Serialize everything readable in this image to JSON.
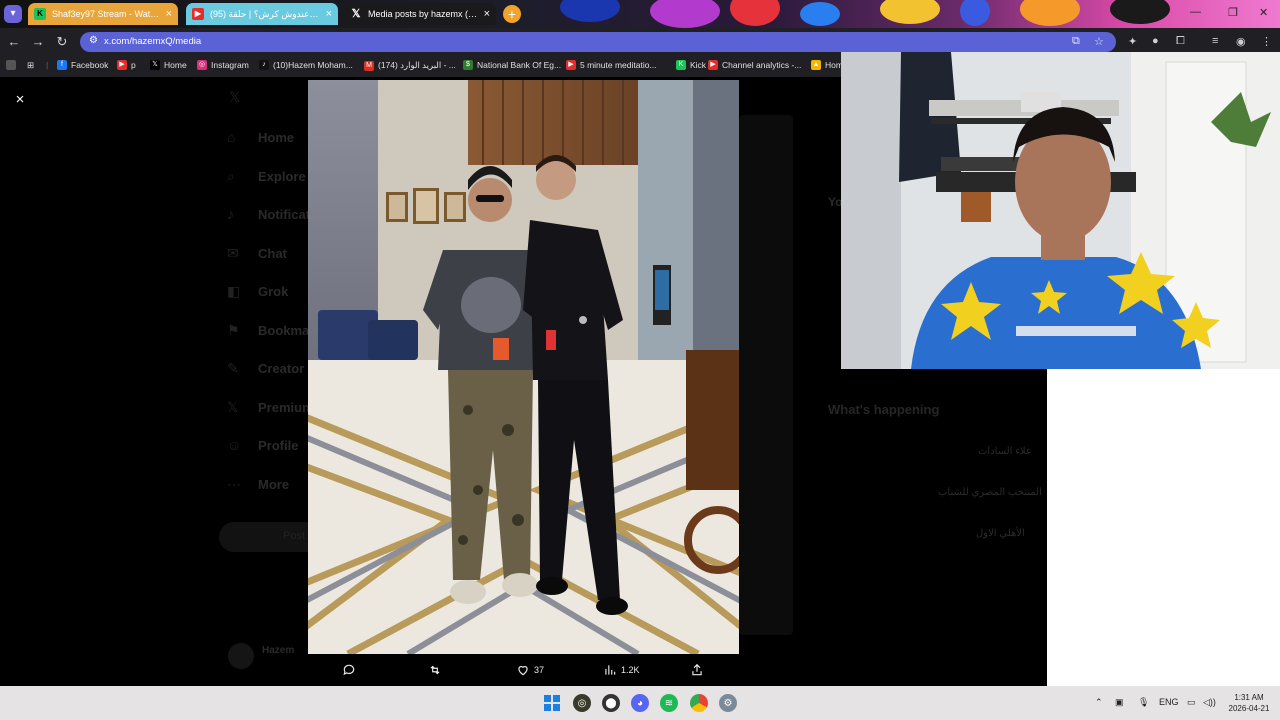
{
  "browser": {
    "tabs": [
      {
        "label": "Shaf3ey97 Stream - Watch Live",
        "favicon": "kick-icon",
        "close": "×"
      },
      {
        "label": "(95) مين ماعندوش كرش؟ | حلقة",
        "favicon": "youtube-icon",
        "close": "×"
      },
      {
        "label": "Media posts by hazemx (@hazemxQ)",
        "favicon": "x-icon",
        "close": "×"
      }
    ],
    "new_tab": "+",
    "url": "x.com/hazemxQ/media",
    "bookmarks": [
      {
        "label": "Facebook",
        "icon": "facebook-icon",
        "color": "#1877f2"
      },
      {
        "label": "p",
        "icon": "youtube-icon",
        "color": "#e62b2b"
      },
      {
        "label": "Home",
        "icon": "x-icon",
        "color": "#000000"
      },
      {
        "label": "Instagram",
        "icon": "instagram-icon",
        "color": "#d6307a"
      },
      {
        "label": "(10)Hazem Moham...",
        "icon": "tiktok-icon",
        "color": "#111111"
      },
      {
        "label": "(174) البريد الوارد - ...",
        "icon": "gmail-icon",
        "color": "#d93025"
      },
      {
        "label": "National Bank Of Eg...",
        "icon": "bank-icon",
        "color": "#2e7d32"
      },
      {
        "label": "5 minute meditatio...",
        "icon": "youtube-icon",
        "color": "#e62b2b"
      },
      {
        "label": "Kick",
        "icon": "kick-icon",
        "color": "#1ec25a"
      },
      {
        "label": "Channel analytics -...",
        "icon": "youtube-icon",
        "color": "#e62b2b"
      },
      {
        "label": "Hom",
        "icon": "drive-icon",
        "color": "#f4b400"
      }
    ]
  },
  "page": {
    "sidebar": [
      "Home",
      "Explore",
      "Notifications",
      "Chat",
      "Grok",
      "Bookmarks",
      "Creator Studio",
      "Premium",
      "Profile",
      "More"
    ],
    "post_button": "Post",
    "account": "Hazem",
    "whats_happening": "What's happening",
    "trends": [
      "علاء السادات",
      "المنتخب المصري للشباب",
      "الأهلي الاول"
    ]
  },
  "media_viewer": {
    "close": "×",
    "actions": {
      "reply": "",
      "repost": "",
      "likes": "37",
      "views": "1.2K",
      "share": ""
    }
  },
  "taskbar": {
    "lang": "ENG",
    "time": "1:31 AM",
    "date": "2026-04-21"
  }
}
